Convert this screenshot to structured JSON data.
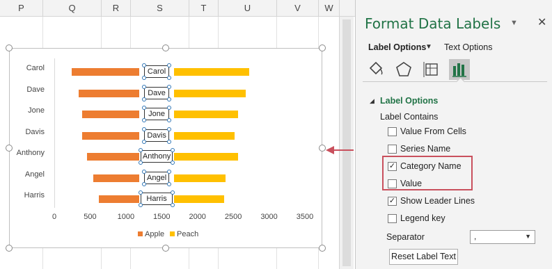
{
  "spreadsheet": {
    "columns": [
      "P",
      "Q",
      "R",
      "S",
      "T",
      "U",
      "V",
      "W"
    ]
  },
  "chart_data": {
    "type": "bar",
    "categories": [
      "Carol",
      "Dave",
      "Jone",
      "Davis",
      "Anthony",
      "Angel",
      "Harris"
    ],
    "series": [
      {
        "name": "Apple",
        "values": [
          950,
          850,
          800,
          800,
          730,
          650,
          570
        ],
        "color": "#ed7d31"
      },
      {
        "name": "Peach",
        "values": [
          1050,
          1000,
          900,
          850,
          900,
          720,
          700
        ],
        "color": "#ffc000"
      }
    ],
    "label_column_width": 480,
    "xticks": [
      "0",
      "500",
      "1000",
      "1500",
      "2000",
      "2500",
      "3000",
      "3500"
    ],
    "xlim": [
      0,
      3500
    ],
    "legend_position": "bottom",
    "grid": false
  },
  "panel": {
    "title": "Format Data Labels",
    "tabs": {
      "label_options": "Label Options",
      "text_options": "Text Options"
    },
    "icons": [
      "fill-line-icon",
      "effects-icon",
      "size-properties-icon",
      "label-options-chart-icon"
    ],
    "section_title": "Label Options",
    "label_contains": "Label Contains",
    "checkboxes": [
      {
        "label": "Value From Cells",
        "checked": false
      },
      {
        "label": "Series Name",
        "checked": false
      },
      {
        "label": "Category Name",
        "checked": true
      },
      {
        "label": "Value",
        "checked": false
      },
      {
        "label": "Show Leader Lines",
        "checked": true
      },
      {
        "label": "Legend key",
        "checked": false
      }
    ],
    "separator_label": "Separator",
    "separator_value": ",",
    "reset_button": "Reset Label Text"
  },
  "colors": {
    "accent_green": "#217346",
    "highlight_red": "#c9505d",
    "apple": "#ed7d31",
    "peach": "#ffc000"
  }
}
